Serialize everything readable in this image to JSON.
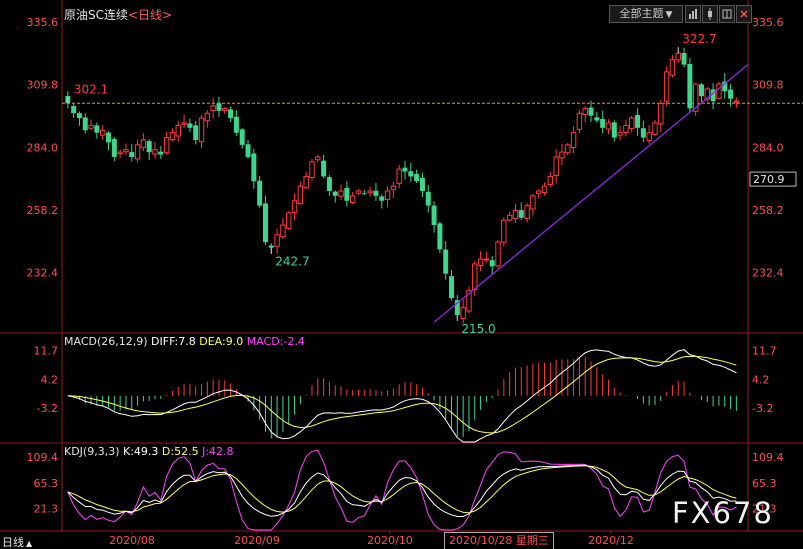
{
  "header": {
    "title": "原油SC连续",
    "period": "<日线>",
    "theme_button": "全部主题",
    "theme_arrow": "▼"
  },
  "footer": {
    "period_label": "日线",
    "period_arrow": "▲",
    "cursor_date": "2020/10/28 星期三"
  },
  "watermark": "FX678",
  "colors": {
    "up": "#ff3a3a",
    "down": "#3dd68c",
    "axis_text": "#ff4d4d",
    "diff": "#ffffff",
    "dea": "#ffff55",
    "macd": "#ff44ff",
    "trend": "#8a2be2",
    "ref_line": "#e0a020"
  },
  "chart_data": [
    {
      "type": "candlestick",
      "title": "原油SC连续",
      "y_ticks": [
        "335.6",
        "309.8",
        "284.0",
        "258.2",
        "232.4"
      ],
      "ylim": [
        208,
        338
      ],
      "x_ticks": [
        "2020/08",
        "2020/09",
        "2020/10",
        "2020/12"
      ],
      "current_price": "270.9",
      "reference_level": 302.1,
      "annotations": [
        {
          "label": "302.1",
          "value": 302.1
        },
        {
          "label": "242.7",
          "value": 242.7
        },
        {
          "label": "215.0",
          "value": 215.0
        },
        {
          "label": "322.7",
          "value": 322.7
        }
      ],
      "trendline": {
        "from": 212,
        "to": 318
      },
      "close_path": [
        302.1,
        298,
        296,
        291,
        293,
        290,
        291,
        286,
        280,
        282,
        283,
        280,
        285,
        287,
        282,
        283,
        281,
        288,
        290,
        293,
        294,
        292,
        287,
        296,
        298,
        301,
        299,
        300,
        296,
        290,
        285,
        280,
        270,
        260,
        245,
        242.7,
        248,
        252,
        257,
        262,
        268,
        272,
        278,
        280,
        272,
        266,
        264,
        266,
        262,
        264,
        266,
        265,
        266,
        264,
        262,
        266,
        268,
        275,
        274,
        272,
        270,
        266,
        260,
        252,
        242,
        232,
        222,
        215,
        218,
        225,
        236,
        238,
        238,
        235,
        245,
        254,
        256,
        258,
        255,
        260,
        264,
        266,
        268,
        272,
        280,
        282,
        285,
        290,
        298,
        300,
        297,
        295,
        292,
        294,
        288,
        290,
        293,
        296,
        292,
        288,
        290,
        294,
        302,
        315,
        320,
        322.7,
        318,
        300,
        310,
        305,
        308,
        303,
        310,
        307,
        304,
        303
      ],
      "macd": {
        "name": "MACD(26,12,9)",
        "diff_label": "DIFF:7.8",
        "dea_label": "DEA:9.0",
        "macd_label": "MACD:-2.4",
        "y_ticks": [
          "11.7",
          "4.2",
          "-3.2"
        ],
        "ylim": [
          -12,
          15
        ]
      },
      "kdj": {
        "name": "KDJ(9,3,3)",
        "k_label": "K:49.3",
        "d_label": "D:52.5",
        "j_label": "J:42.8",
        "y_ticks": [
          "109.4",
          "65.3",
          "21.3"
        ],
        "ylim": [
          -15,
          125
        ]
      }
    }
  ]
}
